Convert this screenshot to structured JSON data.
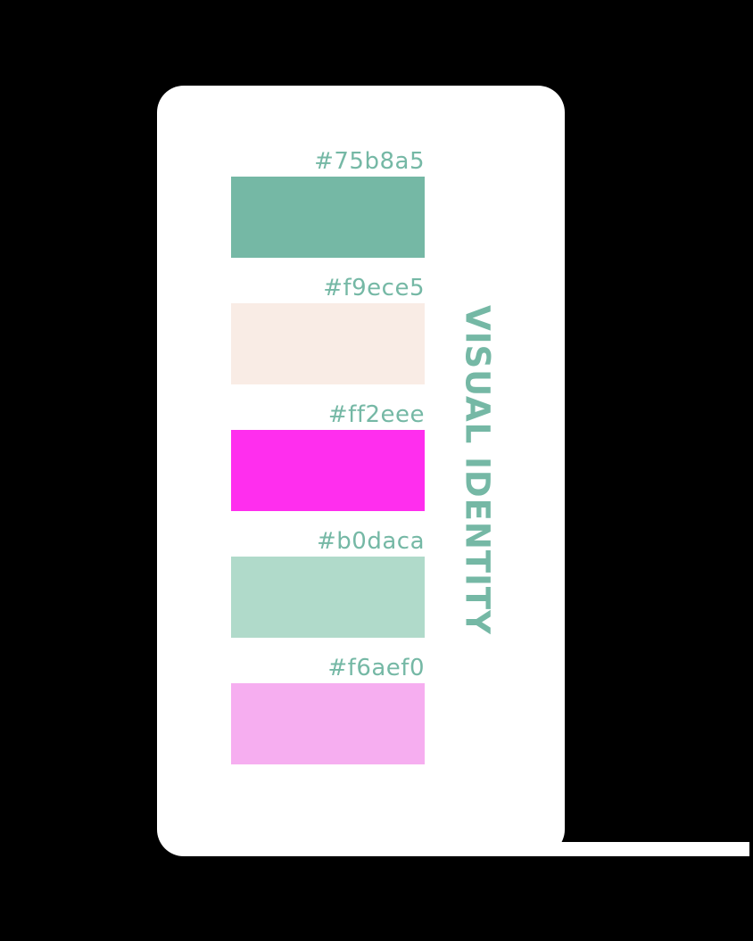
{
  "title": "VISUAL IDENTITY",
  "palette": [
    {
      "hex_label": "#75b8a5",
      "color": "#75b8a5"
    },
    {
      "hex_label": "#f9ece5",
      "color": "#f9ece5"
    },
    {
      "hex_label": "#ff2eee",
      "color": "#ff2eee"
    },
    {
      "hex_label": "#b0daca",
      "color": "#b0daca"
    },
    {
      "hex_label": "#f6aef0",
      "color": "#f6aef0"
    }
  ],
  "colors": {
    "background": "#000000",
    "card": "#ffffff",
    "text_accent": "#75b8a5"
  }
}
